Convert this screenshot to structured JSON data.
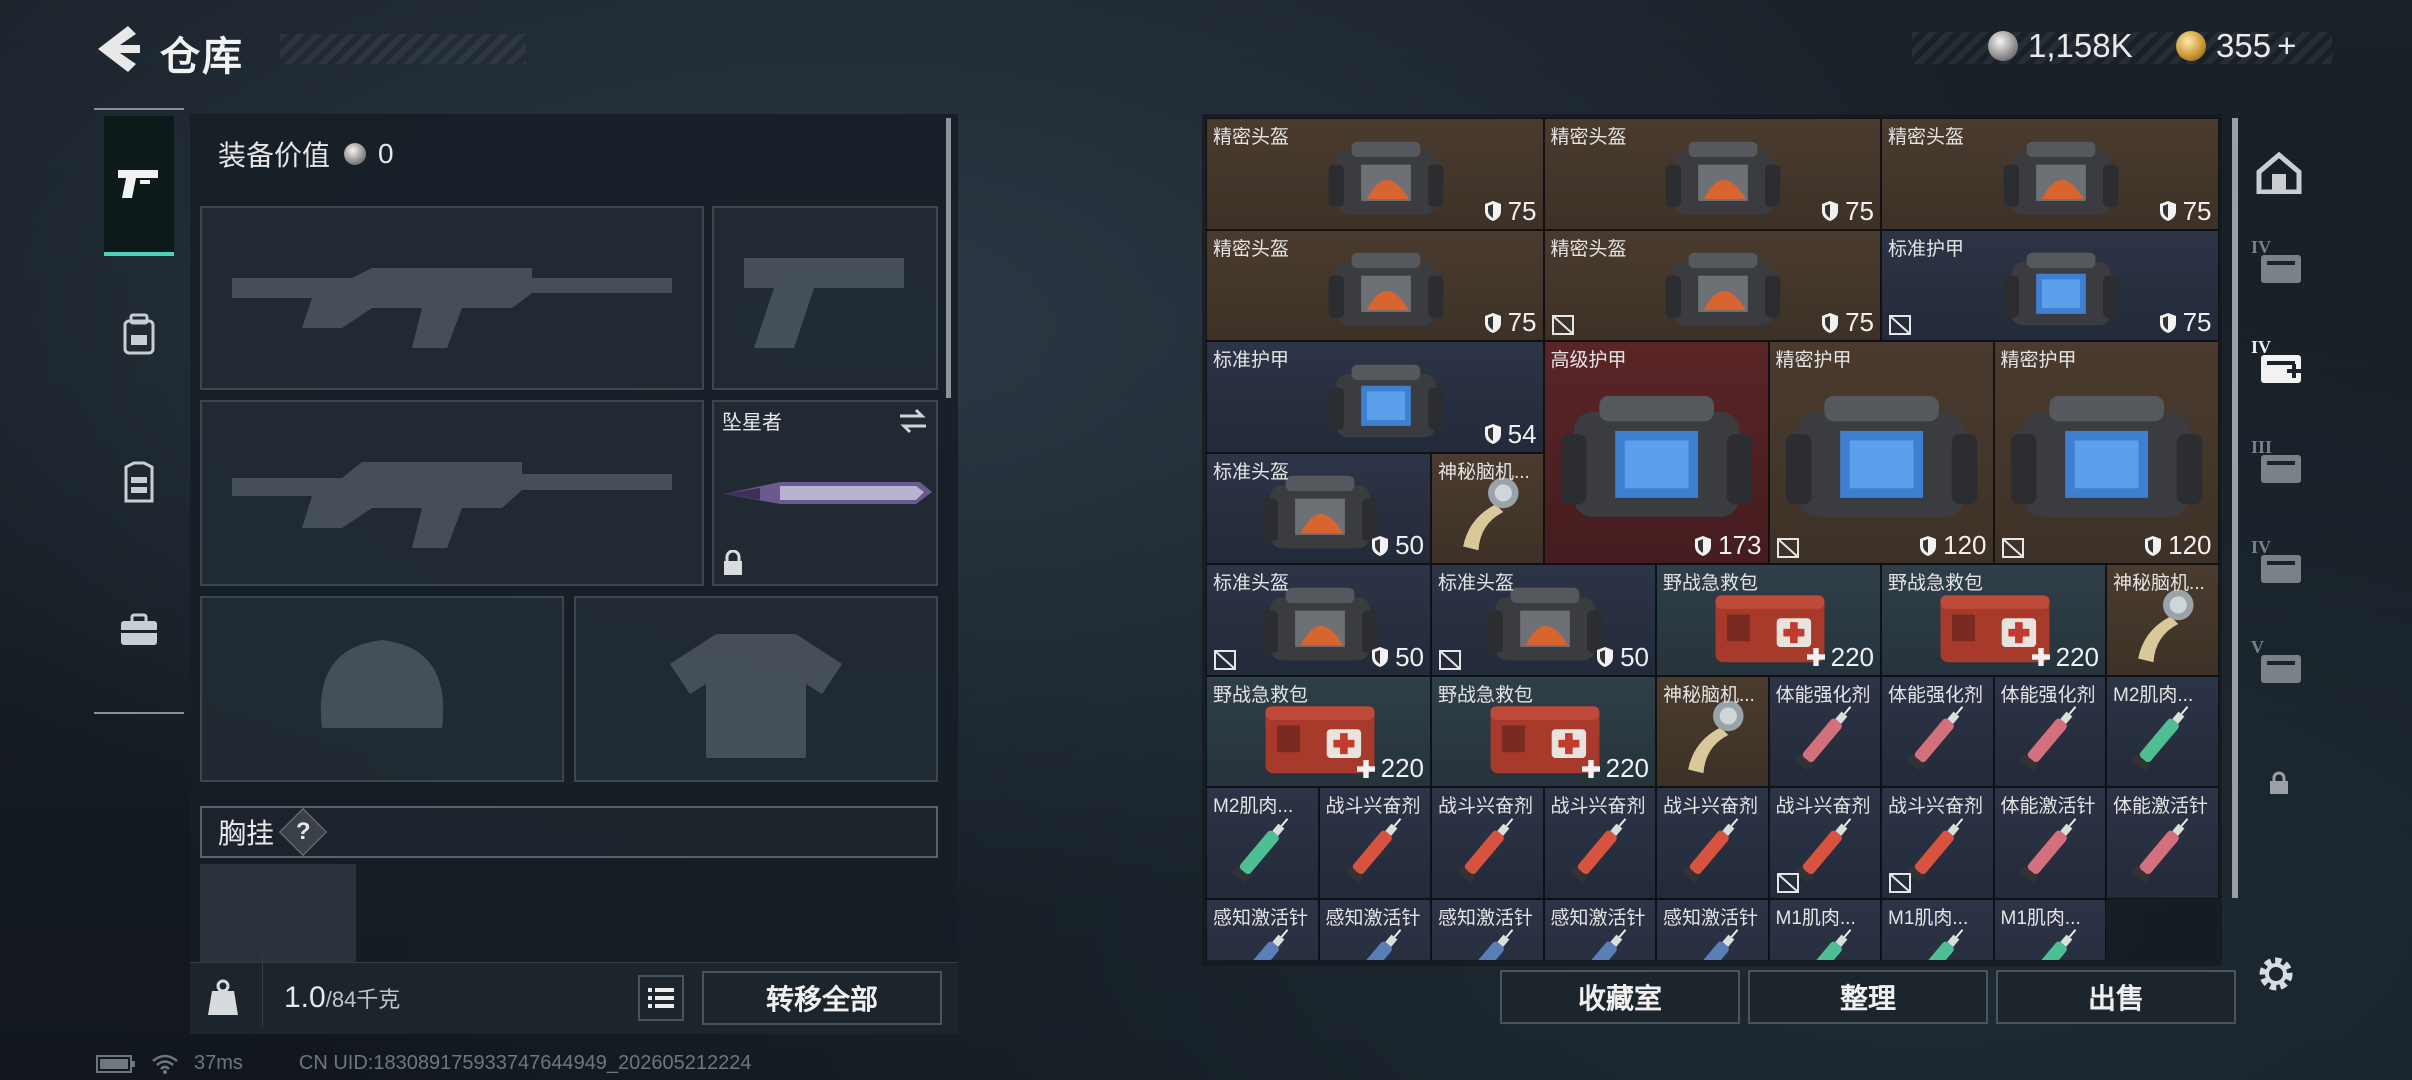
{
  "header": {
    "title": "仓库",
    "back_icon": "back-arrow-icon"
  },
  "currency": {
    "silver_value": "1,158K",
    "gold_value": "355",
    "plus": "+"
  },
  "left_tabs": [
    {
      "icon": "pistol-icon",
      "active": true
    },
    {
      "icon": "backpack-icon",
      "active": false
    },
    {
      "icon": "vest-icon",
      "active": false
    },
    {
      "icon": "toolbox-icon",
      "active": false
    }
  ],
  "equipment": {
    "value_label": "装备价值",
    "value": "0",
    "melee_name": "坠星者",
    "chest_label": "胸挂",
    "chest_help": "?"
  },
  "weight": {
    "current": "1.0",
    "capacity": "/84千克",
    "icon": "weight-icon"
  },
  "buttons": {
    "transfer_all": "转移全部",
    "collection": "收藏室",
    "sort": "整理",
    "sell": "出售"
  },
  "inventory": [
    {
      "name": "精密头盔",
      "value": "75",
      "kind": "helmet",
      "tint": "brown",
      "badge": "shield",
      "nodur": false
    },
    {
      "name": "精密头盔",
      "value": "75",
      "kind": "helmet",
      "tint": "brown",
      "badge": "shield",
      "nodur": false
    },
    {
      "name": "精密头盔",
      "value": "75",
      "kind": "helmet",
      "tint": "brown",
      "badge": "shield",
      "nodur": false
    },
    {
      "name": "精密头盔",
      "value": "75",
      "kind": "helmet",
      "tint": "brown",
      "badge": "shield",
      "nodur": false
    },
    {
      "name": "精密头盔",
      "value": "75",
      "kind": "helmet",
      "tint": "brown",
      "badge": "shield",
      "nodur": true
    },
    {
      "name": "标准护甲",
      "value": "75",
      "kind": "armor",
      "tint": "blue",
      "badge": "shield",
      "nodur": true
    },
    {
      "name": "标准护甲",
      "value": "54",
      "kind": "armor",
      "tint": "blue",
      "badge": "shield",
      "nodur": false
    },
    {
      "name": "高级护甲",
      "value": "173",
      "kind": "armor-big",
      "tint": "red",
      "badge": "shield",
      "nodur": false
    },
    {
      "name": "精密护甲",
      "value": "120",
      "kind": "armor-big",
      "tint": "brown",
      "badge": "shield",
      "nodur": true
    },
    {
      "name": "精密护甲",
      "value": "120",
      "kind": "armor-big",
      "tint": "brown",
      "badge": "shield",
      "nodur": true
    },
    {
      "name": "标准头盔",
      "value": "50",
      "kind": "helmet",
      "tint": "blue",
      "badge": "shield",
      "nodur": false
    },
    {
      "name": "神秘脑机...",
      "value": "",
      "kind": "brain",
      "tint": "brown",
      "badge": "",
      "nodur": false
    },
    {
      "name": "标准头盔",
      "value": "50",
      "kind": "helmet",
      "tint": "blue",
      "badge": "shield",
      "nodur": true
    },
    {
      "name": "标准头盔",
      "value": "50",
      "kind": "helmet",
      "tint": "blue",
      "badge": "shield",
      "nodur": true
    },
    {
      "name": "野战急救包",
      "value": "220",
      "kind": "medkit",
      "tint": "teal",
      "badge": "plus",
      "nodur": false
    },
    {
      "name": "野战急救包",
      "value": "220",
      "kind": "medkit",
      "tint": "teal",
      "badge": "plus",
      "nodur": false
    },
    {
      "name": "神秘脑机...",
      "value": "",
      "kind": "brain",
      "tint": "brown",
      "badge": "",
      "nodur": false
    },
    {
      "name": "野战急救包",
      "value": "220",
      "kind": "medkit",
      "tint": "teal",
      "badge": "plus",
      "nodur": false
    },
    {
      "name": "野战急救包",
      "value": "220",
      "kind": "medkit",
      "tint": "teal",
      "badge": "plus",
      "nodur": false
    },
    {
      "name": "神秘脑机...",
      "value": "",
      "kind": "brain",
      "tint": "brown",
      "badge": "",
      "nodur": false
    },
    {
      "name": "体能强化剂",
      "value": "",
      "kind": "syringe-pink",
      "tint": "blue",
      "badge": "",
      "nodur": false
    },
    {
      "name": "体能强化剂",
      "value": "",
      "kind": "syringe-pink",
      "tint": "blue",
      "badge": "",
      "nodur": false
    },
    {
      "name": "体能强化剂",
      "value": "",
      "kind": "syringe-pink",
      "tint": "blue",
      "badge": "",
      "nodur": false
    },
    {
      "name": "M2肌肉...",
      "value": "",
      "kind": "syringe-green",
      "tint": "blue",
      "badge": "",
      "nodur": false
    },
    {
      "name": "M2肌肉...",
      "value": "",
      "kind": "syringe-green",
      "tint": "blue",
      "badge": "",
      "nodur": false
    },
    {
      "name": "战斗兴奋剂",
      "value": "",
      "kind": "syringe-red",
      "tint": "blue",
      "badge": "",
      "nodur": false
    },
    {
      "name": "战斗兴奋剂",
      "value": "",
      "kind": "syringe-red",
      "tint": "blue",
      "badge": "",
      "nodur": false
    },
    {
      "name": "战斗兴奋剂",
      "value": "",
      "kind": "syringe-red",
      "tint": "blue",
      "badge": "",
      "nodur": false
    },
    {
      "name": "战斗兴奋剂",
      "value": "",
      "kind": "syringe-red",
      "tint": "blue",
      "badge": "",
      "nodur": false
    },
    {
      "name": "战斗兴奋剂",
      "value": "",
      "kind": "syringe-red",
      "tint": "blue",
      "badge": "",
      "nodur": true
    },
    {
      "name": "战斗兴奋剂",
      "value": "",
      "kind": "syringe-red",
      "tint": "blue",
      "badge": "",
      "nodur": true
    },
    {
      "name": "体能激活针",
      "value": "",
      "kind": "syringe-pink",
      "tint": "blue",
      "badge": "",
      "nodur": false
    },
    {
      "name": "体能激活针",
      "value": "",
      "kind": "syringe-pink",
      "tint": "blue",
      "badge": "",
      "nodur": false
    },
    {
      "name": "感知激活针",
      "value": "",
      "kind": "syringe-blue",
      "tint": "blue",
      "badge": "",
      "nodur": false
    },
    {
      "name": "感知激活针",
      "value": "",
      "kind": "syringe-blue",
      "tint": "blue",
      "badge": "",
      "nodur": false
    },
    {
      "name": "感知激活针",
      "value": "",
      "kind": "syringe-blue",
      "tint": "blue",
      "badge": "",
      "nodur": false
    },
    {
      "name": "感知激活针",
      "value": "",
      "kind": "syringe-blue",
      "tint": "blue",
      "badge": "",
      "nodur": false
    },
    {
      "name": "感知激活针",
      "value": "",
      "kind": "syringe-blue",
      "tint": "blue",
      "badge": "",
      "nodur": false
    },
    {
      "name": "M1肌肉...",
      "value": "",
      "kind": "syringe-green",
      "tint": "blue",
      "badge": "",
      "nodur": false
    },
    {
      "name": "M1肌肉...",
      "value": "",
      "kind": "syringe-green",
      "tint": "blue",
      "badge": "",
      "nodur": false
    },
    {
      "name": "M1肌肉...",
      "value": "",
      "kind": "syringe-green",
      "tint": "blue",
      "badge": "",
      "nodur": false
    }
  ],
  "right_tabs": [
    {
      "icon": "house-icon",
      "label": ""
    },
    {
      "icon": "tier-4-storage-icon",
      "label": "IV"
    },
    {
      "icon": "tier-4-medical-icon",
      "label": "IV"
    },
    {
      "icon": "tier-3-storage-icon",
      "label": "III"
    },
    {
      "icon": "tier-4-storage-icon",
      "label": "IV"
    },
    {
      "icon": "tier-5-storage-icon",
      "label": "V"
    },
    {
      "icon": "lock-icon",
      "label": ""
    }
  ],
  "status": {
    "ping": "37ms",
    "uid": "CN UID:1830891759337476449​49_202605212224"
  }
}
